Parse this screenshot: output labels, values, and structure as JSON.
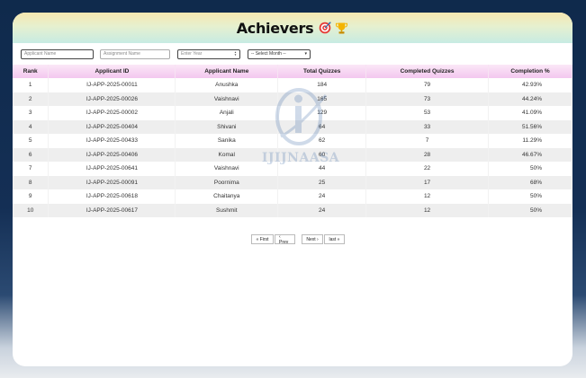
{
  "header": {
    "title": "Achievers"
  },
  "filters": {
    "applicant_name_placeholder": "Applicant Name",
    "assignment_name_placeholder": "Assignment Name",
    "year_placeholder": "Enter Year",
    "month_selected": "-- Select Month --"
  },
  "table": {
    "columns": [
      "Rank",
      "Applicant ID",
      "Applicant Name",
      "Total Quizzes",
      "Completed Quizzes",
      "Completion %"
    ],
    "rows": [
      [
        "1",
        "IJ-APP-2025-00011",
        "Anushka",
        "184",
        "79",
        "42.93%"
      ],
      [
        "2",
        "IJ-APP-2025-00026",
        "Vaishnavi",
        "165",
        "73",
        "44.24%"
      ],
      [
        "3",
        "IJ-APP-2025-00002",
        "Anjali",
        "129",
        "53",
        "41.09%"
      ],
      [
        "4",
        "IJ-APP-2025-00404",
        "Shivani",
        "64",
        "33",
        "51.56%"
      ],
      [
        "5",
        "IJ-APP-2025-00433",
        "Sanika",
        "62",
        "7",
        "11.29%"
      ],
      [
        "6",
        "IJ-APP-2025-00406",
        "Komal",
        "60",
        "28",
        "46.67%"
      ],
      [
        "7",
        "IJ-APP-2025-00641",
        "Vaishnavi",
        "44",
        "22",
        "50%"
      ],
      [
        "8",
        "IJ-APP-2025-00091",
        "Poornima",
        "25",
        "17",
        "68%"
      ],
      [
        "9",
        "IJ-APP-2025-00618",
        "Chaitanya",
        "24",
        "12",
        "50%"
      ],
      [
        "10",
        "IJ-APP-2025-00617",
        "Sushmit",
        "24",
        "12",
        "50%"
      ]
    ]
  },
  "watermark": {
    "text": "IJIJNAASA"
  },
  "pagination": {
    "first": "« First",
    "prev": "‹ Prev",
    "next": "Next ›",
    "last": "last »"
  },
  "icons": {
    "title_icons": [
      "target-icon",
      "trophy-icon"
    ]
  },
  "colors": {
    "header_gradient_top": "#f6e7b0",
    "header_gradient_bottom": "#c7ebe3",
    "table_header": "#f3c7ef",
    "row_stripe": "#eeeeee"
  }
}
